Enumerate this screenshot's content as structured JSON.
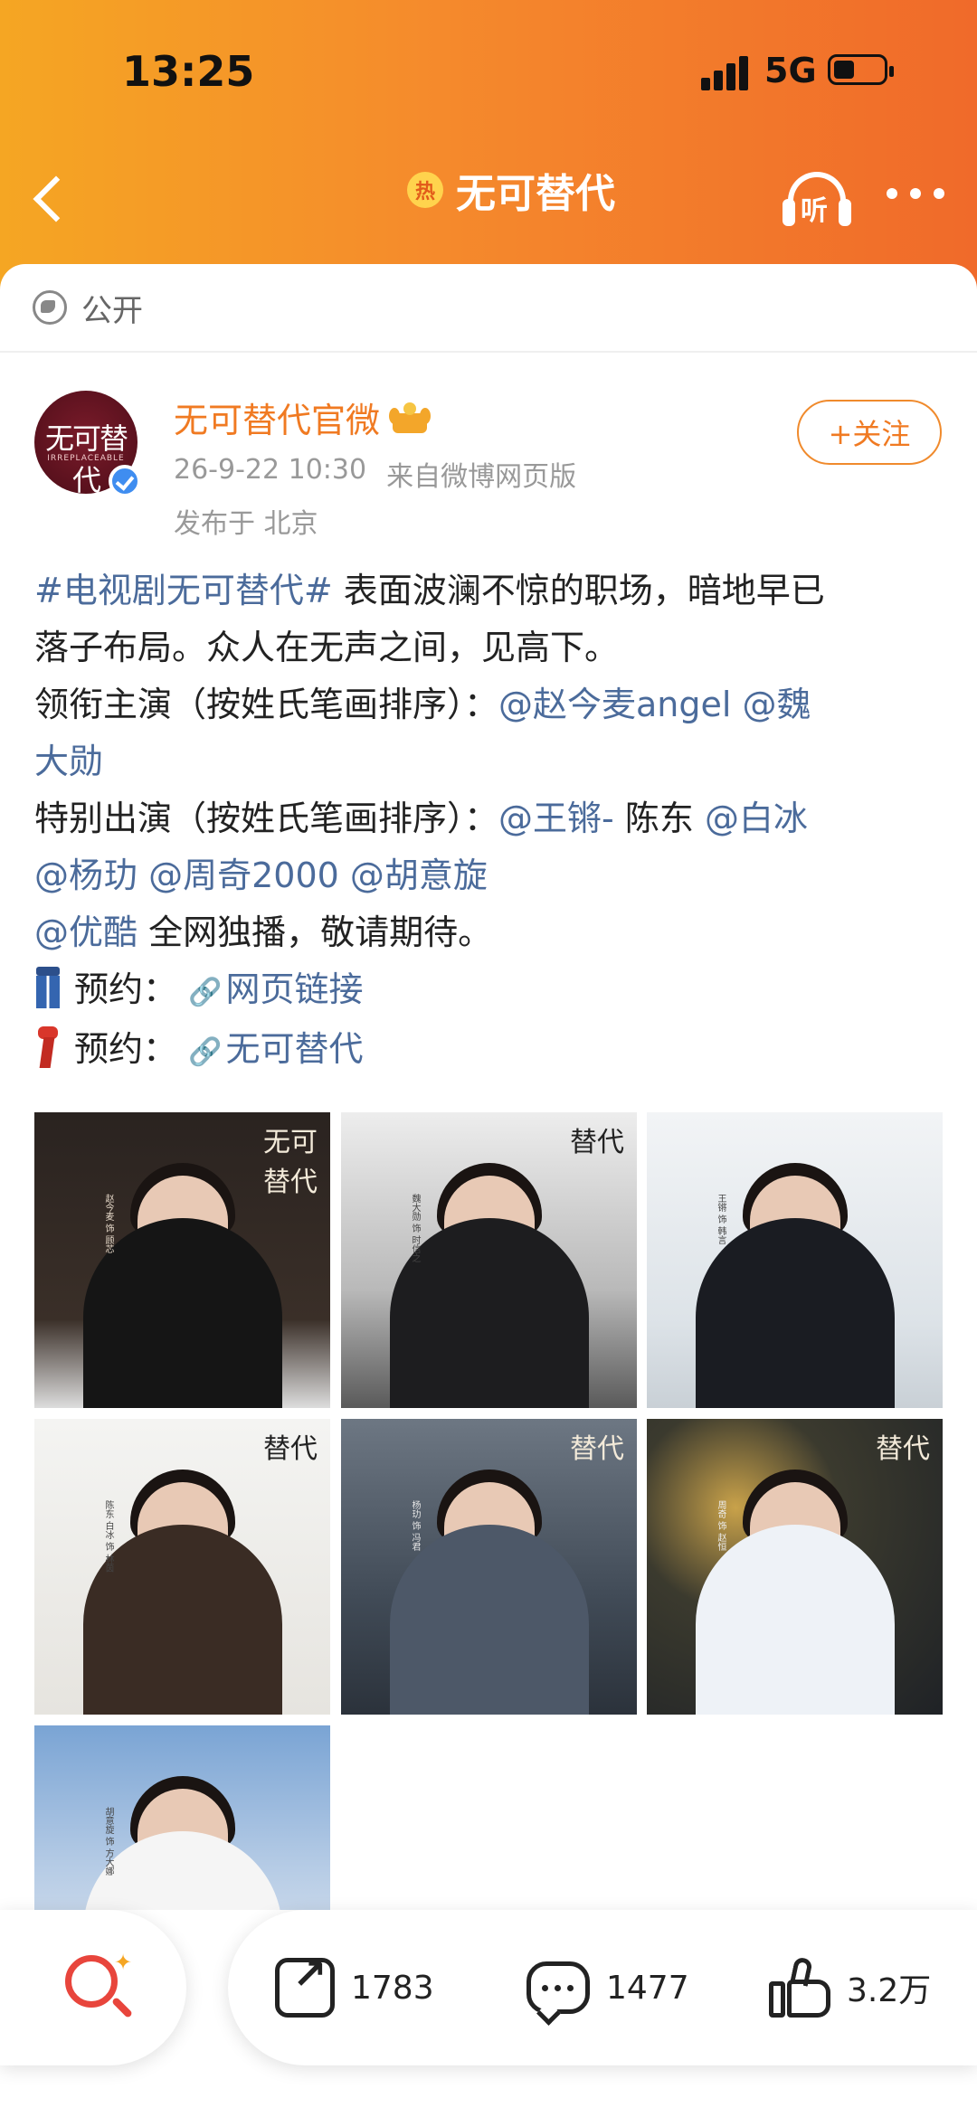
{
  "status_bar": {
    "time": "13:25",
    "network": "5G"
  },
  "nav": {
    "title": "无可替代",
    "hot_badge": "热",
    "listen_label": "听"
  },
  "post": {
    "visibility": "公开",
    "author": {
      "name": "无可替代官微",
      "date": "26-9-22 10:30",
      "source": "来自微博网页版",
      "location": "发布于 北京",
      "avatar_logo": "无可替代",
      "avatar_logo_sub": "IRREPLACEABLE",
      "follow_label": "+关注"
    },
    "content": {
      "l1_tag": "#电视剧无可替代#",
      "l1_text": " 表面波澜不惊的职场，暗地早已",
      "l2_text": "落子布局。众人在无声之间，见高下。",
      "l3_text": "领衔主演（按姓氏笔画排序）：",
      "l3_m1": "@赵今麦angel",
      "l3_m2": "@魏",
      "l4_m2": "大勋",
      "l5_text": "特别出演（按姓氏笔画排序）：",
      "l5_m1": "@王锵-",
      "l5_t2": "陈东",
      "l5_m2": "@白冰",
      "l6_m1": "@杨玏",
      "l6_m2": "@周奇2000",
      "l6_m3": "@胡意旋",
      "l7_m1": "@优酷",
      "l7_text": " 全网独播，敬请期待。",
      "l8_label": "预约：",
      "l8_link": "网页链接",
      "l9_label": "预约：",
      "l9_link": "无可替代"
    },
    "photos": [
      {
        "tag": "无可\n替代",
        "caption": "赵今麦 饰 顾芯"
      },
      {
        "tag": "替代",
        "caption": "魏大勋 饰 时信之"
      },
      {
        "tag": "",
        "caption": "王锵 饰 韩言"
      },
      {
        "tag": "替代",
        "caption": "陈东 白冰 饰 林茵"
      },
      {
        "tag": "替代",
        "caption": "杨玏 饰 冯君"
      },
      {
        "tag": "替代",
        "caption": "周奇 饰 赵恒"
      },
      {
        "tag": "",
        "caption": "胡意旋 饰 方大娜"
      }
    ]
  },
  "bottom_bar": {
    "share_count": "1783",
    "comment_count": "1477",
    "like_count": "3.2万"
  },
  "colors": {
    "accent": "#f07a22",
    "link": "#4b6b9b",
    "header_start": "#f5a623",
    "header_end": "#f06a2a"
  }
}
